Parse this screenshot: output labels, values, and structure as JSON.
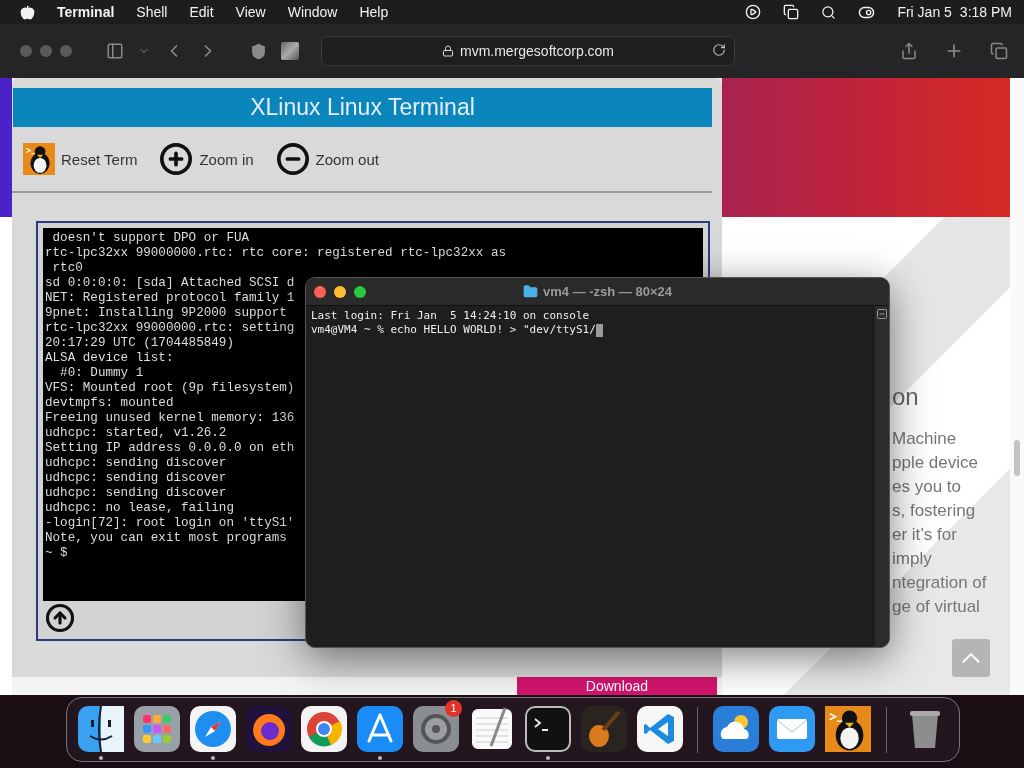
{
  "menu_bar": {
    "app": "Terminal",
    "menus": [
      "Shell",
      "Edit",
      "View",
      "Window",
      "Help"
    ],
    "date": "Fri Jan 5",
    "time": "3:18 PM"
  },
  "browser": {
    "address": "mvm.mergesoftcorp.com"
  },
  "xlinux": {
    "title": "XLinux Linux Terminal",
    "tools": [
      {
        "kind": "penguin",
        "label": "Reset Term"
      },
      {
        "kind": "plus",
        "label": "Zoom in"
      },
      {
        "kind": "minus",
        "label": "Zoom out"
      }
    ],
    "console_lines": [
      " doesn't support DPO or FUA",
      "rtc-lpc32xx 99000000.rtc: rtc core: registered rtc-lpc32xx as",
      " rtc0",
      "sd 0:0:0:0: [sda] Attached SCSI d",
      "NET: Registered protocol family 1",
      "9pnet: Installing 9P2000 support",
      "rtc-lpc32xx 99000000.rtc: setting",
      "20:17:29 UTC (1704485849)",
      "ALSA device list:",
      "  #0: Dummy 1",
      "VFS: Mounted root (9p filesystem)",
      "devtmpfs: mounted",
      "Freeing unused kernel memory: 136",
      "udhcpc: started, v1.26.2",
      "Setting IP address 0.0.0.0 on eth",
      "udhcpc: sending discover",
      "udhcpc: sending discover",
      "udhcpc: sending discover",
      "udhcpc: no lease, failing",
      "-login[72]: root login on 'ttyS1'",
      "Note, you can exit most programs",
      "~ $"
    ]
  },
  "download_button": "Download",
  "web_page": {
    "heading": "on",
    "lines": [
      "Machine",
      "pple device",
      "es you to",
      "s, fostering",
      "er it’s for",
      "imply",
      "ntegration of",
      "ge of virtual"
    ]
  },
  "terminal_window": {
    "title": "vm4 — -zsh — 80×24",
    "lines": [
      "Last login: Fri Jan  5 14:24:10 on console",
      "vm4@VM4 ~ % echo HELLO WORLD! > \"dev/ttyS1/"
    ],
    "cursor": true
  },
  "dock": {
    "groups": [
      [
        {
          "kind": "face",
          "running": true
        },
        {
          "kind": "grid",
          "running": false
        },
        {
          "kind": "compass",
          "running": true
        },
        {
          "kind": "fox",
          "running": false
        },
        {
          "kind": "ring",
          "running": false
        },
        {
          "kind": "letter",
          "running": true
        },
        {
          "kind": "gear",
          "running": false,
          "badge": "1"
        },
        {
          "kind": "notepad",
          "running": false
        },
        {
          "kind": "prompt",
          "running": true
        },
        {
          "kind": "guitar",
          "running": false
        },
        {
          "kind": "ribbon",
          "running": false
        }
      ],
      [
        {
          "kind": "cloud",
          "running": false
        },
        {
          "kind": "envelope",
          "running": false
        },
        {
          "kind": "penguin",
          "running": false
        }
      ],
      [
        {
          "kind": "bin",
          "running": false
        }
      ]
    ]
  }
}
